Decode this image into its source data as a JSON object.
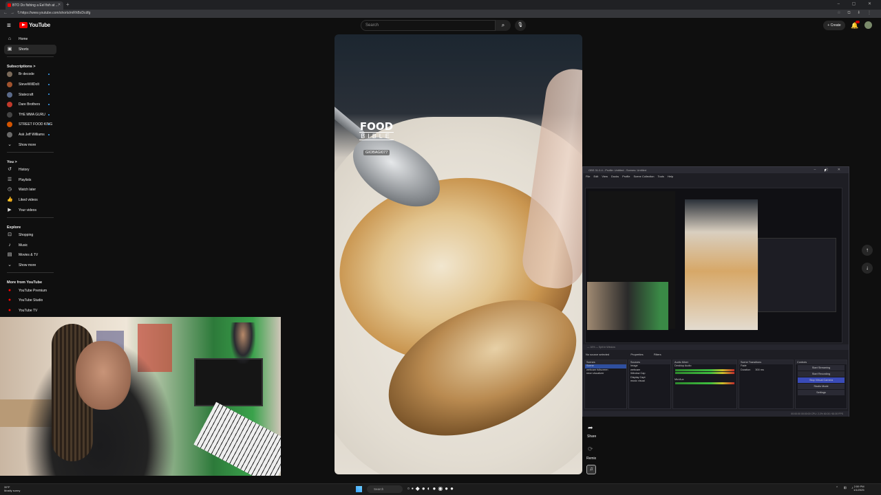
{
  "browser": {
    "tab_title": "BTO Do fishing a Eel fish at ...",
    "url": "https://www.youtube.com/shorts/mRhBxDcdfg",
    "window_controls": "– ▢ ✕"
  },
  "header": {
    "logo_text": "YouTube",
    "search_placeholder": "Search",
    "create_label": "+ Create",
    "notification_count": "9+"
  },
  "sidebar": {
    "main": [
      {
        "label": "Home",
        "icon": "home-icon"
      },
      {
        "label": "Shorts",
        "icon": "shorts-icon",
        "active": true
      }
    ],
    "subscriptions_heading": "Subscriptions  >",
    "subscriptions": [
      {
        "label": "Br decode",
        "color": "#7a6a5a"
      },
      {
        "label": "SteveWillDoIt",
        "color": "#a0522d"
      },
      {
        "label": "Statecraft",
        "color": "#5a6a8a"
      },
      {
        "label": "Dare Brothers",
        "color": "#c0392b"
      },
      {
        "label": "THE MMA GURU",
        "color": "#444"
      },
      {
        "label": "STREET FOOD KING",
        "color": "#d35400"
      },
      {
        "label": "Ask Jeff Williams",
        "color": "#6a6a6a"
      }
    ],
    "show_more_1": "Show more",
    "you_heading": "You  >",
    "you": [
      {
        "label": "History",
        "icon": "history-icon"
      },
      {
        "label": "Playlists",
        "icon": "playlists-icon"
      },
      {
        "label": "Watch later",
        "icon": "clock-icon"
      },
      {
        "label": "Liked videos",
        "icon": "like-icon"
      },
      {
        "label": "Your videos",
        "icon": "video-icon"
      }
    ],
    "explore_heading": "Explore",
    "explore": [
      {
        "label": "Shopping",
        "icon": "bag-icon"
      },
      {
        "label": "Music",
        "icon": "music-icon"
      },
      {
        "label": "Movies & TV",
        "icon": "film-icon"
      }
    ],
    "show_more_2": "Show more",
    "more_heading": "More from YouTube",
    "more": [
      {
        "label": "YouTube Premium"
      },
      {
        "label": "YouTube Studio"
      },
      {
        "label": "YouTube TV"
      }
    ]
  },
  "short": {
    "logo_line1": "FOOD",
    "logo_line2": "BIBLE",
    "handle": "GIOBAGI077",
    "share_label": "Share",
    "remix_label": "Remix"
  },
  "obs": {
    "title": "OBS 31.0.4 - Profile: Untitled - Scenes: Untitled",
    "menu": [
      "File",
      "Edit",
      "View",
      "Docks",
      "Profile",
      "Scene Collection",
      "Tools",
      "Help"
    ],
    "status_top": "— 16% — Split in Window",
    "no_source": "No source selected",
    "properties": "Properties",
    "filters": "Filters",
    "docks": {
      "scenes": {
        "title": "Scenes",
        "items": [
          "Scene",
          "webcam fullscreen",
          "neon visualizer"
        ]
      },
      "sources": {
        "title": "Sources",
        "items": [
          "Image",
          "webcam",
          "Window Cap",
          "Display Capt",
          "music visual"
        ]
      },
      "mixer": {
        "title": "Audio Mixer",
        "items": [
          "Desktop Audio",
          "Mic/Aux"
        ]
      },
      "transitions": {
        "title": "Scene Transitions",
        "type": "Fade",
        "duration_label": "Duration",
        "duration": "300 ms"
      },
      "controls": {
        "title": "Controls",
        "buttons": [
          "Start Streaming",
          "Start Recording",
          "Stop Virtual Camera",
          "Studio Mode",
          "Settings"
        ]
      }
    },
    "status_bottom": "00:00:00   00:00:00   CPU: 2.2%   60.00 / 60.00 FPS"
  },
  "taskbar": {
    "weather_temp": "39°F",
    "weather_desc": "Mostly sunny",
    "search_label": "Search",
    "time": "2:59 PM",
    "date": "1/1/2025"
  }
}
